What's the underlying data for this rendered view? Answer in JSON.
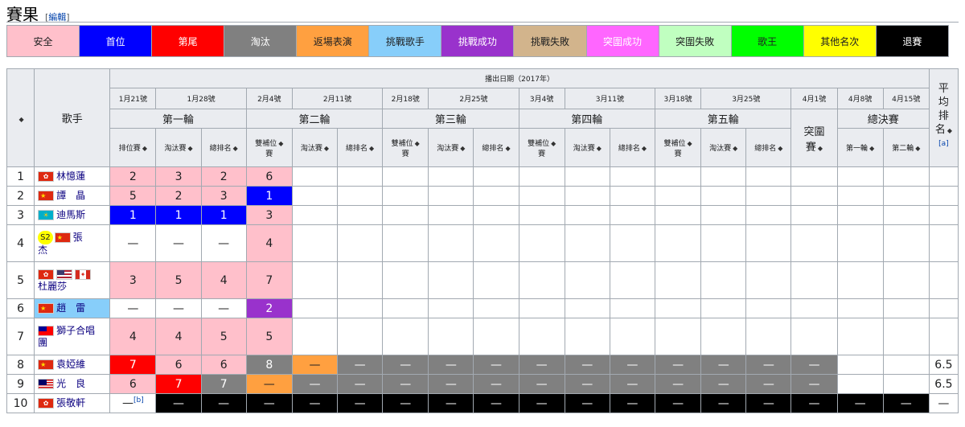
{
  "section": {
    "title": "賽果",
    "edit_label": "編輯",
    "bracket_open": "[",
    "bracket_close": "]"
  },
  "legend": [
    {
      "label": "安全",
      "bg": "#ffc0cb",
      "fg": "#202122"
    },
    {
      "label": "首位",
      "bg": "#0000ff",
      "fg": "#ffffff"
    },
    {
      "label": "第尾",
      "bg": "#ff0000",
      "fg": "#ffffff"
    },
    {
      "label": "淘汰",
      "bg": "#808080",
      "fg": "#ffffff"
    },
    {
      "label": "返場表演",
      "bg": "#ffa040",
      "fg": "#202122"
    },
    {
      "label": "挑戰歌手",
      "bg": "#87cefa",
      "fg": "#202122"
    },
    {
      "label": "挑戰成功",
      "bg": "#9932cc",
      "fg": "#ffffff"
    },
    {
      "label": "挑戰失敗",
      "bg": "#d2b48c",
      "fg": "#202122"
    },
    {
      "label": "突圍成功",
      "bg": "#ff66ff",
      "fg": "#ffffff"
    },
    {
      "label": "突圍失敗",
      "bg": "#c0ffc0",
      "fg": "#202122"
    },
    {
      "label": "歌王",
      "bg": "#00ff00",
      "fg": "#202122"
    },
    {
      "label": "其他名次",
      "bg": "#ffff00",
      "fg": "#202122"
    },
    {
      "label": "退賽",
      "bg": "#000000",
      "fg": "#ffffff"
    }
  ],
  "table": {
    "col_sort_symbol": "◆",
    "singer_header": "歌手",
    "broadcast_header": "播出日期（2017年）",
    "avg_header": [
      "平",
      "均",
      "排",
      "名"
    ],
    "avg_ref": "[a]",
    "dates": [
      "1月21號",
      "1月28號",
      "2月4號",
      "2月11號",
      "2月18號",
      "2月25號",
      "3月4號",
      "3月11號",
      "3月18號",
      "3月25號",
      "4月1號",
      "4月8號",
      "4月15號"
    ],
    "rounds": [
      "第一輪",
      "第二輪",
      "第三輪",
      "第四輪",
      "第五輪"
    ],
    "breakout": [
      "突圍",
      "賽"
    ],
    "final": "總決賽",
    "sub": {
      "ranking": "排位賽",
      "elim": "淘汰賽",
      "total": "總排名",
      "dbl_a": "雙補位",
      "dbl_b": "賽",
      "final1": "第一輪",
      "final2": "第二輪"
    },
    "rows": [
      {
        "n": "1",
        "singer": [
          {
            "flag": "hk"
          },
          {
            "name": "林憶蓮"
          }
        ],
        "cells": [
          [
            "2",
            "pink"
          ],
          [
            "3",
            "pink"
          ],
          [
            "2",
            "pink"
          ],
          [
            "6",
            "pink"
          ]
        ]
      },
      {
        "n": "2",
        "singer": [
          {
            "flag": "cn"
          },
          {
            "name": "譚　晶"
          }
        ],
        "cells": [
          [
            "5",
            "pink"
          ],
          [
            "2",
            "pink"
          ],
          [
            "3",
            "pink"
          ],
          [
            "1",
            "blue"
          ]
        ]
      },
      {
        "n": "3",
        "singer": [
          {
            "flag": "kz"
          },
          {
            "name": "迪馬斯"
          }
        ],
        "cells": [
          [
            "1",
            "blue"
          ],
          [
            "1",
            "blue"
          ],
          [
            "1",
            "blue"
          ],
          [
            "3",
            "pink"
          ]
        ]
      },
      {
        "n": "4",
        "singer": [
          {
            "badge": "S2"
          },
          {
            "flag": "cn"
          },
          {
            "name": "張"
          },
          {
            "br": true
          },
          {
            "name": "杰"
          }
        ],
        "cells": [
          [
            "—",
            "white"
          ],
          [
            "—",
            "white"
          ],
          [
            "—",
            "white"
          ],
          [
            "4",
            "pink"
          ]
        ]
      },
      {
        "n": "5",
        "singer": [
          {
            "flag": "hk"
          },
          {
            "flag": "us"
          },
          {
            "flag": "ca"
          },
          {
            "br": true
          },
          {
            "name": "杜麗莎"
          }
        ],
        "cells": [
          [
            "3",
            "pink"
          ],
          [
            "5",
            "pink"
          ],
          [
            "4",
            "pink"
          ],
          [
            "7",
            "pink"
          ]
        ]
      },
      {
        "n": "6",
        "singer": [
          {
            "flag": "cn"
          },
          {
            "name": "趙　雷"
          }
        ],
        "cells": [
          [
            "—",
            "white"
          ],
          [
            "—",
            "white"
          ],
          [
            "—",
            "white"
          ],
          [
            "2",
            "purple"
          ]
        ],
        "singer_bg": "#87cefa"
      },
      {
        "n": "7",
        "singer": [
          {
            "flag": "tw"
          },
          {
            "name": "獅子合唱"
          },
          {
            "br": true
          },
          {
            "name": "團"
          }
        ],
        "cells": [
          [
            "4",
            "pink"
          ],
          [
            "4",
            "pink"
          ],
          [
            "5",
            "pink"
          ],
          [
            "5",
            "pink"
          ]
        ]
      },
      {
        "n": "8",
        "singer": [
          {
            "flag": "cn"
          },
          {
            "name": "袁婭維"
          }
        ],
        "cells": [
          [
            "7",
            "red"
          ],
          [
            "6",
            "pink"
          ],
          [
            "6",
            "pink"
          ],
          [
            "8",
            "gray"
          ],
          [
            "—",
            "orange"
          ],
          [
            "—",
            "gray"
          ],
          [
            "—",
            "gray"
          ],
          [
            "—",
            "gray"
          ],
          [
            "—",
            "gray"
          ],
          [
            "—",
            "gray"
          ],
          [
            "—",
            "gray"
          ],
          [
            "—",
            "gray"
          ],
          [
            "—",
            "gray"
          ],
          [
            "—",
            "gray"
          ],
          [
            "—",
            "gray"
          ],
          [
            "—",
            "gray"
          ]
        ],
        "avg": "6.5"
      },
      {
        "n": "9",
        "singer": [
          {
            "flag": "my"
          },
          {
            "name": "光　良"
          }
        ],
        "cells": [
          [
            "6",
            "pink"
          ],
          [
            "7",
            "red"
          ],
          [
            "7",
            "gray"
          ],
          [
            "—",
            "orange"
          ],
          [
            "—",
            "gray"
          ],
          [
            "—",
            "gray"
          ],
          [
            "—",
            "gray"
          ],
          [
            "—",
            "gray"
          ],
          [
            "—",
            "gray"
          ],
          [
            "—",
            "gray"
          ],
          [
            "—",
            "gray"
          ],
          [
            "—",
            "gray"
          ],
          [
            "—",
            "gray"
          ],
          [
            "—",
            "gray"
          ],
          [
            "—",
            "gray"
          ],
          [
            "—",
            "gray"
          ]
        ],
        "avg": "6.5"
      },
      {
        "n": "10",
        "singer": [
          {
            "flag": "hk"
          },
          {
            "name": "張敬軒"
          }
        ],
        "cells": [
          [
            "—",
            "white"
          ],
          [
            "—",
            "black"
          ],
          [
            "—",
            "black"
          ],
          [
            "—",
            "black"
          ],
          [
            "—",
            "black"
          ],
          [
            "—",
            "black"
          ],
          [
            "—",
            "black"
          ],
          [
            "—",
            "black"
          ],
          [
            "—",
            "black"
          ],
          [
            "—",
            "black"
          ],
          [
            "—",
            "black"
          ],
          [
            "—",
            "black"
          ],
          [
            "—",
            "black"
          ],
          [
            "—",
            "black"
          ],
          [
            "—",
            "black"
          ],
          [
            "—",
            "black"
          ],
          [
            "—",
            "black"
          ],
          [
            "—",
            "black"
          ],
          [
            "—",
            "black"
          ]
        ],
        "avg": "—",
        "first_ref": "[b]"
      }
    ]
  },
  "cell_colors": {
    "pink": "#ffc0cb",
    "blue": "#0000ff",
    "red": "#ff0000",
    "gray": "#808080",
    "orange": "#ffa040",
    "purple": "#9932cc",
    "black": "#000000",
    "white": "#ffffff"
  },
  "cell_text_colors": {
    "pink": "#202122",
    "blue": "#ffffff",
    "red": "#ffffff",
    "gray": "#ffffff",
    "orange": "#202122",
    "purple": "#ffffff",
    "black": "#ffffff",
    "white": "#202122"
  }
}
